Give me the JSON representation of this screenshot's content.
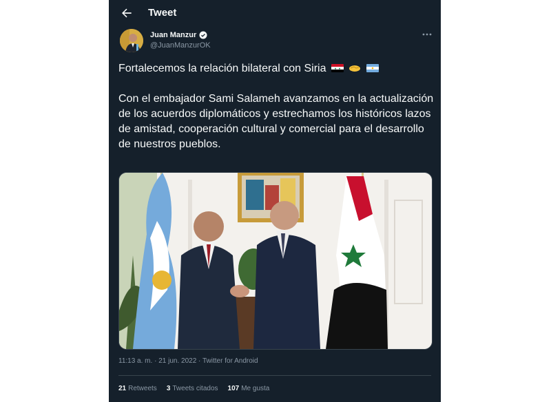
{
  "header": {
    "title": "Tweet"
  },
  "author": {
    "name": "Juan Manzur",
    "handle": "@JuanManzurOK"
  },
  "tweet": {
    "line1": "Fortalecemos la relación bilateral con Siria",
    "body": "Con el embajador Sami Salameh avanzamos en la actualización de los acuerdos diplomáticos y estrechamos los históricos lazos de amistad, cooperación cultural y comercial para el desarrollo de nuestros pueblos.",
    "emojis": [
      "syria-flag",
      "handshake",
      "argentina-flag"
    ]
  },
  "meta": {
    "time": "11:13 a. m.",
    "sep1": "·",
    "date": "21 jun. 2022",
    "sep2": "·",
    "source": "Twitter for Android"
  },
  "stats": [
    {
      "count": "21",
      "label": "Retweets"
    },
    {
      "count": "3",
      "label": "Tweets citados"
    },
    {
      "count": "107",
      "label": "Me gusta"
    }
  ],
  "colors": {
    "panel_bg": "#15202b",
    "text": "#f7f9f9",
    "muted": "#8b98a5",
    "border": "#38444d",
    "accent": "#1d9bf0"
  }
}
